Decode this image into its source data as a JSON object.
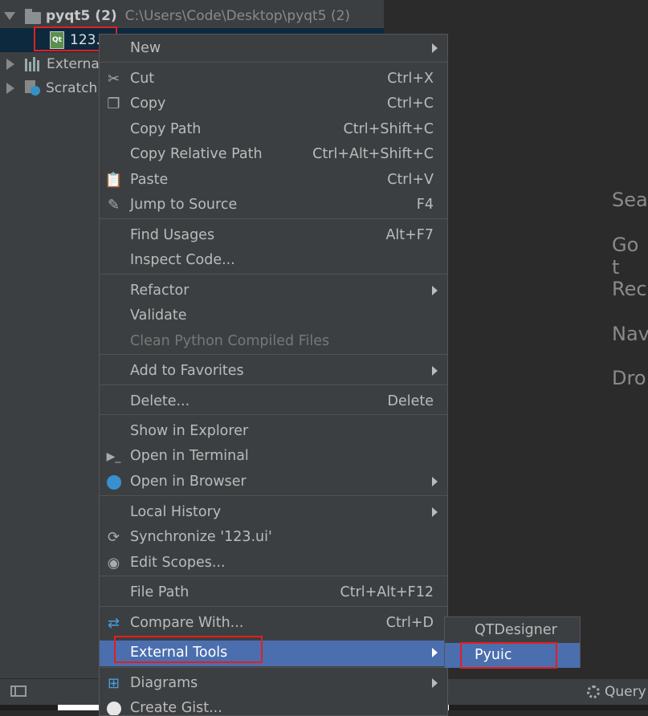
{
  "project_tree": {
    "root_name": "pyqt5 (2)",
    "root_path": "C:\\Users\\Code\\Desktop\\pyqt5 (2)",
    "selected_file": "123.",
    "external_libraries": "Externa",
    "scratches": "Scratch",
    "qt_badge": "Qt"
  },
  "welcome": {
    "items": [
      "Sea",
      "Go t",
      "Rec",
      "Nav",
      "Dro"
    ]
  },
  "context_menu": {
    "new": "New",
    "cut": {
      "label": "Cut",
      "shortcut": "Ctrl+X"
    },
    "copy": {
      "label": "Copy",
      "shortcut": "Ctrl+C"
    },
    "copy_path": {
      "label": "Copy Path",
      "shortcut": "Ctrl+Shift+C"
    },
    "copy_relative_path": {
      "label": "Copy Relative Path",
      "shortcut": "Ctrl+Alt+Shift+C"
    },
    "paste": {
      "label": "Paste",
      "shortcut": "Ctrl+V"
    },
    "jump_to_source": {
      "label": "Jump to Source",
      "shortcut": "F4"
    },
    "find_usages": {
      "label": "Find Usages",
      "shortcut": "Alt+F7"
    },
    "inspect_code": "Inspect Code...",
    "refactor": "Refactor",
    "validate": "Validate",
    "clean_python": "Clean Python Compiled Files",
    "add_to_favorites": "Add to Favorites",
    "delete": {
      "label": "Delete...",
      "shortcut": "Delete"
    },
    "show_in_explorer": "Show in Explorer",
    "open_in_terminal": "Open in Terminal",
    "open_in_browser": "Open in Browser",
    "local_history": "Local History",
    "synchronize": "Synchronize '123.ui'",
    "edit_scopes": "Edit Scopes...",
    "file_path": {
      "label": "File Path",
      "shortcut": "Ctrl+Alt+F12"
    },
    "compare_with": {
      "label": "Compare With...",
      "shortcut": "Ctrl+D"
    },
    "external_tools": "External Tools",
    "diagrams": "Diagrams",
    "create_gist": "Create Gist..."
  },
  "external_tools_submenu": {
    "items": [
      "QTDesigner",
      "Pyuic"
    ]
  },
  "status_bar": {
    "right_text": "Query"
  },
  "colors": {
    "menu_bg": "#3c3f41",
    "highlight": "#4b6eaf",
    "annotation_red": "#e02020"
  }
}
